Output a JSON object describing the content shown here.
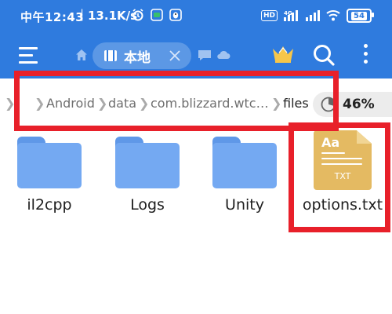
{
  "status_bar": {
    "time": "中午12:43",
    "separator": "|",
    "network_speed": "13.1K/s",
    "right_icons": [
      "hd-badge",
      "4g-signal-icon",
      "signal-bars-icon",
      "wifi-icon"
    ],
    "hd_label": "HD",
    "battery": "54"
  },
  "toolbar": {
    "menu_icon": "hamburger-menu-icon",
    "tab": {
      "label": "本地",
      "icon": "local-storage-icon"
    },
    "actions": [
      "crown-icon",
      "search-icon",
      "more-vertical-icon"
    ]
  },
  "path": {
    "crumbs": [
      "Android",
      "data",
      "com.blizzard.wtc…"
    ],
    "current": "files",
    "storage_percent": "46%"
  },
  "items": [
    {
      "name": "il2cpp",
      "type": "folder"
    },
    {
      "name": "Logs",
      "type": "folder"
    },
    {
      "name": "Unity",
      "type": "folder"
    },
    {
      "name": "options.txt",
      "type": "txt"
    }
  ],
  "txt_icon": {
    "aa": "Aa",
    "ext": "TXT"
  },
  "colors": {
    "appbar": "#2f7bde",
    "folder": "#74a9f2",
    "txt_file": "#e4ba62",
    "highlight": "#e8202a"
  }
}
